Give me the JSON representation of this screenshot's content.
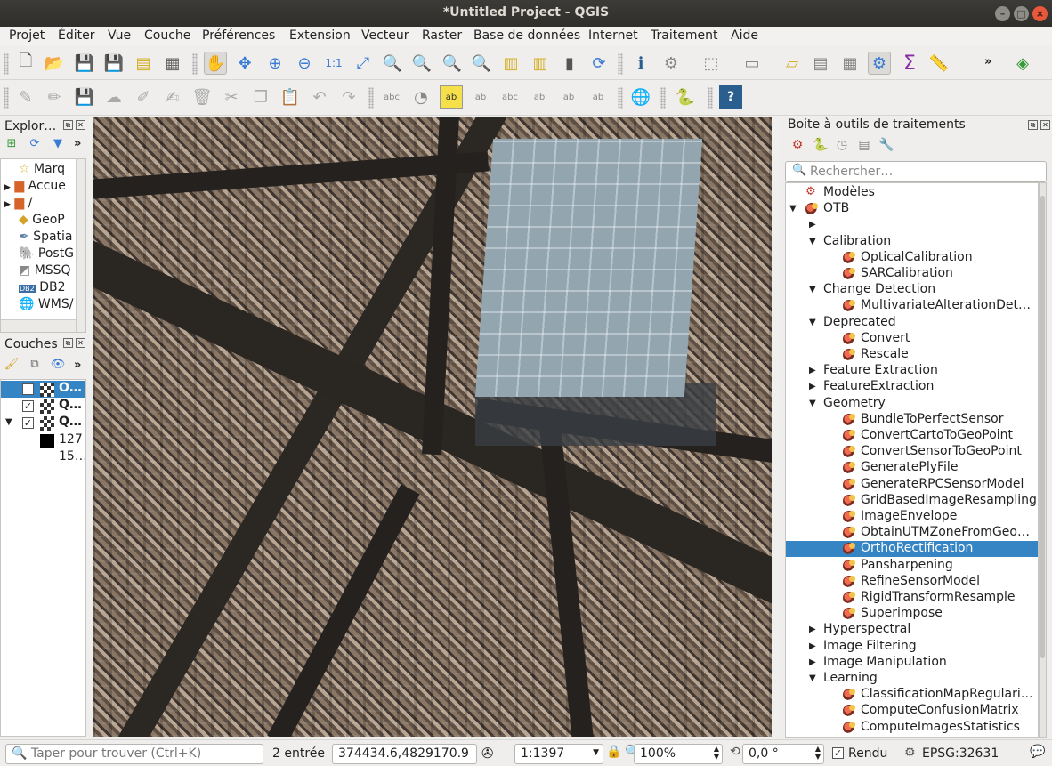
{
  "window": {
    "title": "*Untitled Project - QGIS"
  },
  "menu": [
    "Projet",
    "Éditer",
    "Vue",
    "Couche",
    "Préférences",
    "Extension",
    "Vecteur",
    "Raster",
    "Base de données",
    "Internet",
    "Traitement",
    "Aide"
  ],
  "browser": {
    "title": "Explor…",
    "items": [
      {
        "label": "Marq",
        "icon": "star-icon"
      },
      {
        "label": "Accue",
        "icon": "folder-home-icon"
      },
      {
        "label": "/",
        "icon": "folder-icon"
      },
      {
        "label": "GeoP",
        "icon": "geopackage-icon"
      },
      {
        "label": "Spatia",
        "icon": "spatialite-icon"
      },
      {
        "label": "PostG",
        "icon": "postgis-icon"
      },
      {
        "label": "MSSQ",
        "icon": "mssql-icon"
      },
      {
        "label": "DB2",
        "icon": "db2-icon"
      },
      {
        "label": "WMS/",
        "icon": "wms-icon"
      }
    ]
  },
  "layers": {
    "title": "Couches",
    "items": [
      {
        "label": "O…",
        "checked": true,
        "selected": true
      },
      {
        "label": "Q…",
        "checked": true,
        "selected": false
      },
      {
        "label": "Q…",
        "checked": true,
        "selected": false,
        "expanded": true
      }
    ],
    "legend": [
      "127",
      "15…"
    ]
  },
  "processing": {
    "title": "Boite à outils de traitements",
    "search_placeholder": "Rechercher…",
    "tree": [
      {
        "label": "Modèles",
        "level": 0,
        "kind": "models"
      },
      {
        "label": "OTB",
        "level": 0,
        "kind": "provider",
        "expanded": true
      },
      {
        "label": "",
        "level": 1,
        "kind": "group",
        "expanded": false
      },
      {
        "label": "Calibration",
        "level": 1,
        "kind": "group",
        "expanded": true
      },
      {
        "label": "OpticalCalibration",
        "level": 2,
        "kind": "alg"
      },
      {
        "label": "SARCalibration",
        "level": 2,
        "kind": "alg"
      },
      {
        "label": "Change Detection",
        "level": 1,
        "kind": "group",
        "expanded": true
      },
      {
        "label": "MultivariateAlterationDet…",
        "level": 2,
        "kind": "alg"
      },
      {
        "label": "Deprecated",
        "level": 1,
        "kind": "group",
        "expanded": true
      },
      {
        "label": "Convert",
        "level": 2,
        "kind": "alg"
      },
      {
        "label": "Rescale",
        "level": 2,
        "kind": "alg"
      },
      {
        "label": "Feature Extraction",
        "level": 1,
        "kind": "group",
        "expanded": false
      },
      {
        "label": "FeatureExtraction",
        "level": 1,
        "kind": "group",
        "expanded": false
      },
      {
        "label": "Geometry",
        "level": 1,
        "kind": "group",
        "expanded": true
      },
      {
        "label": "BundleToPerfectSensor",
        "level": 2,
        "kind": "alg"
      },
      {
        "label": "ConvertCartoToGeoPoint",
        "level": 2,
        "kind": "alg"
      },
      {
        "label": "ConvertSensorToGeoPoint",
        "level": 2,
        "kind": "alg"
      },
      {
        "label": "GeneratePlyFile",
        "level": 2,
        "kind": "alg"
      },
      {
        "label": "GenerateRPCSensorModel",
        "level": 2,
        "kind": "alg"
      },
      {
        "label": "GridBasedImageResampling",
        "level": 2,
        "kind": "alg"
      },
      {
        "label": "ImageEnvelope",
        "level": 2,
        "kind": "alg"
      },
      {
        "label": "ObtainUTMZoneFromGeo…",
        "level": 2,
        "kind": "alg"
      },
      {
        "label": "OrthoRectification",
        "level": 2,
        "kind": "alg",
        "selected": true
      },
      {
        "label": "Pansharpening",
        "level": 2,
        "kind": "alg"
      },
      {
        "label": "RefineSensorModel",
        "level": 2,
        "kind": "alg"
      },
      {
        "label": "RigidTransformResample",
        "level": 2,
        "kind": "alg"
      },
      {
        "label": "Superimpose",
        "level": 2,
        "kind": "alg"
      },
      {
        "label": "Hyperspectral",
        "level": 1,
        "kind": "group",
        "expanded": false
      },
      {
        "label": "Image Filtering",
        "level": 1,
        "kind": "group",
        "expanded": false
      },
      {
        "label": "Image Manipulation",
        "level": 1,
        "kind": "group",
        "expanded": false
      },
      {
        "label": "Learning",
        "level": 1,
        "kind": "group",
        "expanded": true
      },
      {
        "label": "ClassificationMapRegulari…",
        "level": 2,
        "kind": "alg"
      },
      {
        "label": "ComputeConfusionMatrix",
        "level": 2,
        "kind": "alg"
      },
      {
        "label": "ComputeImagesStatistics",
        "level": 2,
        "kind": "alg"
      }
    ]
  },
  "status": {
    "locator_placeholder": "Taper pour trouver (Ctrl+K)",
    "message": "2 entrée",
    "coordinate": "374434.6,4829170.9",
    "scale": "1:1397",
    "magnifier": "100%",
    "rotation": "0,0 °",
    "render_label": "Rendu",
    "render_checked": true,
    "crs": "EPSG:32631"
  },
  "colors": {
    "selection": "#3584c3",
    "titlebar": "#3c3b37",
    "close_button": "#e8583a"
  }
}
